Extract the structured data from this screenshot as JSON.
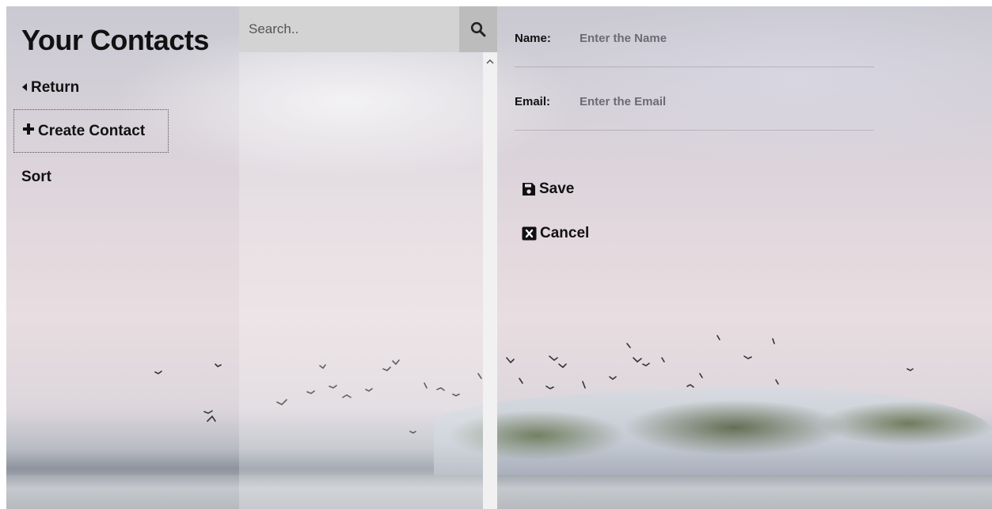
{
  "sidebar": {
    "title": "Your Contacts",
    "return_label": "Return",
    "create_label": "Create Contact",
    "sort_label": "Sort"
  },
  "search": {
    "placeholder": "Search..",
    "icon": "search-icon"
  },
  "form": {
    "name_label": "Name:",
    "name_placeholder": "Enter the Name",
    "email_label": "Email:",
    "email_placeholder": "Enter the Email",
    "save_label": "Save",
    "cancel_label": "Cancel"
  },
  "icons": {
    "return": "caret-left-icon",
    "create": "plus-icon",
    "save": "floppy-disk-icon",
    "cancel": "close-box-icon",
    "scroll_up": "chevron-up-icon"
  }
}
